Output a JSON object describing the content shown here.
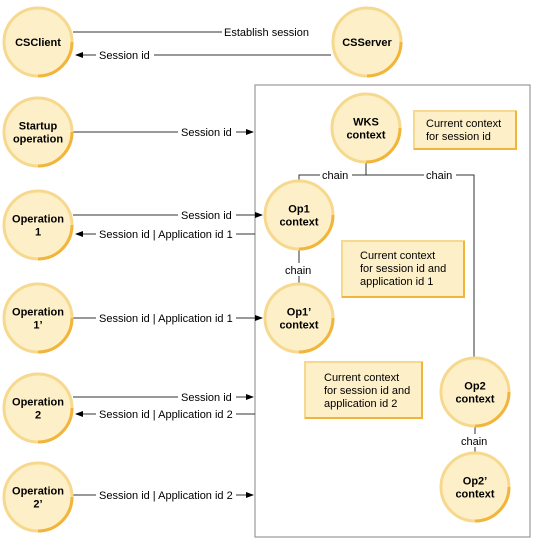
{
  "nodes": {
    "csclient": [
      "CSClient"
    ],
    "csserver": [
      "CSServer"
    ],
    "startup": [
      "Startup",
      "operation"
    ],
    "op1": [
      "Operation",
      "1"
    ],
    "op1p": [
      "Operation",
      "1’"
    ],
    "op2": [
      "Operation",
      "2"
    ],
    "op2p": [
      "Operation",
      "2’"
    ],
    "wks": [
      "WKS",
      "context"
    ],
    "op1ctx": [
      "Op1",
      "context"
    ],
    "op1pctx": [
      "Op1’",
      "context"
    ],
    "op2ctx": [
      "Op2",
      "context"
    ],
    "op2pctx": [
      "Op2’",
      "context"
    ]
  },
  "arrows": {
    "establish": "Establish session",
    "session_back": "Session id",
    "startup": "Session id",
    "op1_in": "Session id",
    "op1_out": "Session id | Application id 1",
    "op1p_in": "Session id | Application id 1",
    "op2_in": "Session id",
    "op2_out": "Session id | Application id 2",
    "op2p_in": "Session id | Application id 2"
  },
  "chain_label": "chain",
  "notes": {
    "wks": [
      "Current context",
      "for session id"
    ],
    "op1": [
      "Current context",
      "for session id and",
      "application id 1"
    ],
    "op2": [
      "Current context",
      "for session id and",
      "application id 2"
    ]
  },
  "colors": {
    "node_fill": "#fdf0c9",
    "node_border": "#f6d98e",
    "node_accent": "#f3b43a"
  }
}
